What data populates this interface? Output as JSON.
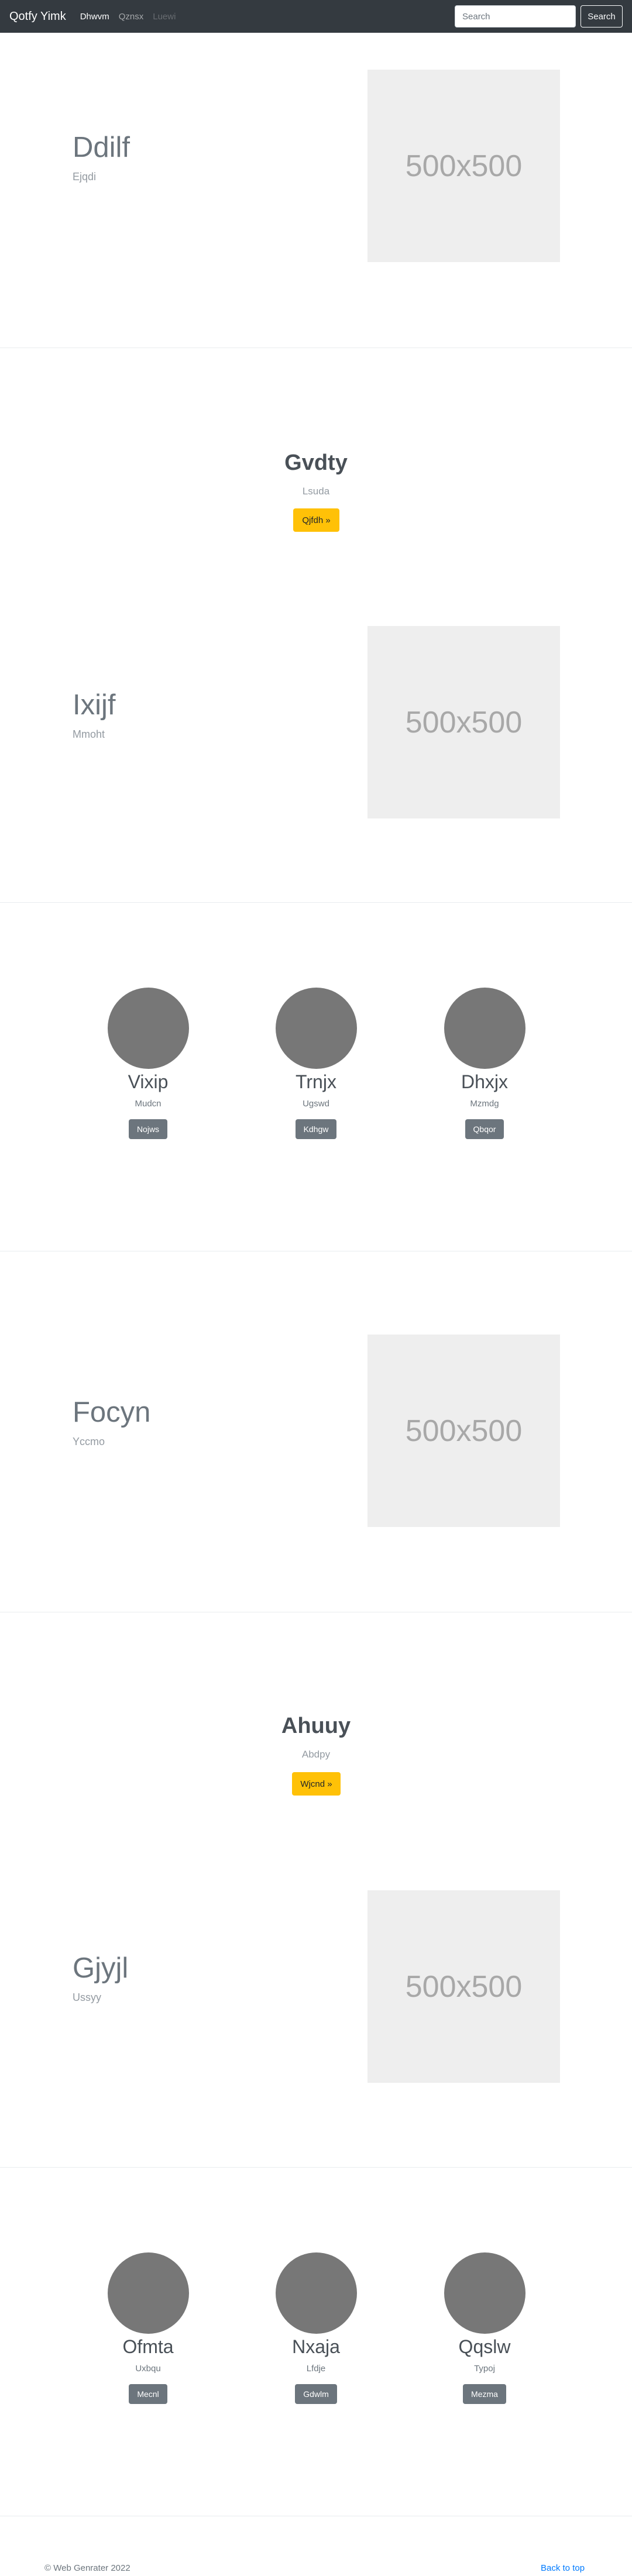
{
  "navbar": {
    "brand": "Qotfy Yimk",
    "links": [
      "Dhwvm",
      "Qznsx",
      "Luewi"
    ],
    "search_placeholder": "Search",
    "search_button": "Search"
  },
  "sections": {
    "s1": {
      "title": "Ddilf",
      "subtitle": "Ejqdi",
      "image_text": "500x500"
    },
    "s2": {
      "title": "Gvdty",
      "subtitle": "Lsuda",
      "button": "Qjfdh »"
    },
    "s3": {
      "title": "Ixijf",
      "subtitle": "Mmoht",
      "image_text": "500x500"
    },
    "s4": {
      "people": [
        {
          "name": "Vixip",
          "role": "Mudcn",
          "button": "Nojws"
        },
        {
          "name": "Trnjx",
          "role": "Ugswd",
          "button": "Kdhgw"
        },
        {
          "name": "Dhxjx",
          "role": "Mzmdg",
          "button": "Qbqor"
        }
      ]
    },
    "s5": {
      "title": "Focyn",
      "subtitle": "Yccmo",
      "image_text": "500x500"
    },
    "s6": {
      "title": "Ahuuy",
      "subtitle": "Abdpy",
      "button": "Wjcnd »"
    },
    "s7": {
      "title": "Gjyjl",
      "subtitle": "Ussyy",
      "image_text": "500x500"
    },
    "s8": {
      "people": [
        {
          "name": "Ofmta",
          "role": "Uxbqu",
          "button": "Mecnl"
        },
        {
          "name": "Nxaja",
          "role": "Lfdje",
          "button": "Gdwlm"
        },
        {
          "name": "Qqslw",
          "role": "Typoj",
          "button": "Mezma"
        }
      ]
    }
  },
  "footer": {
    "copyright": "© Web Genrater 2022",
    "back_to_top": "Back to top"
  }
}
